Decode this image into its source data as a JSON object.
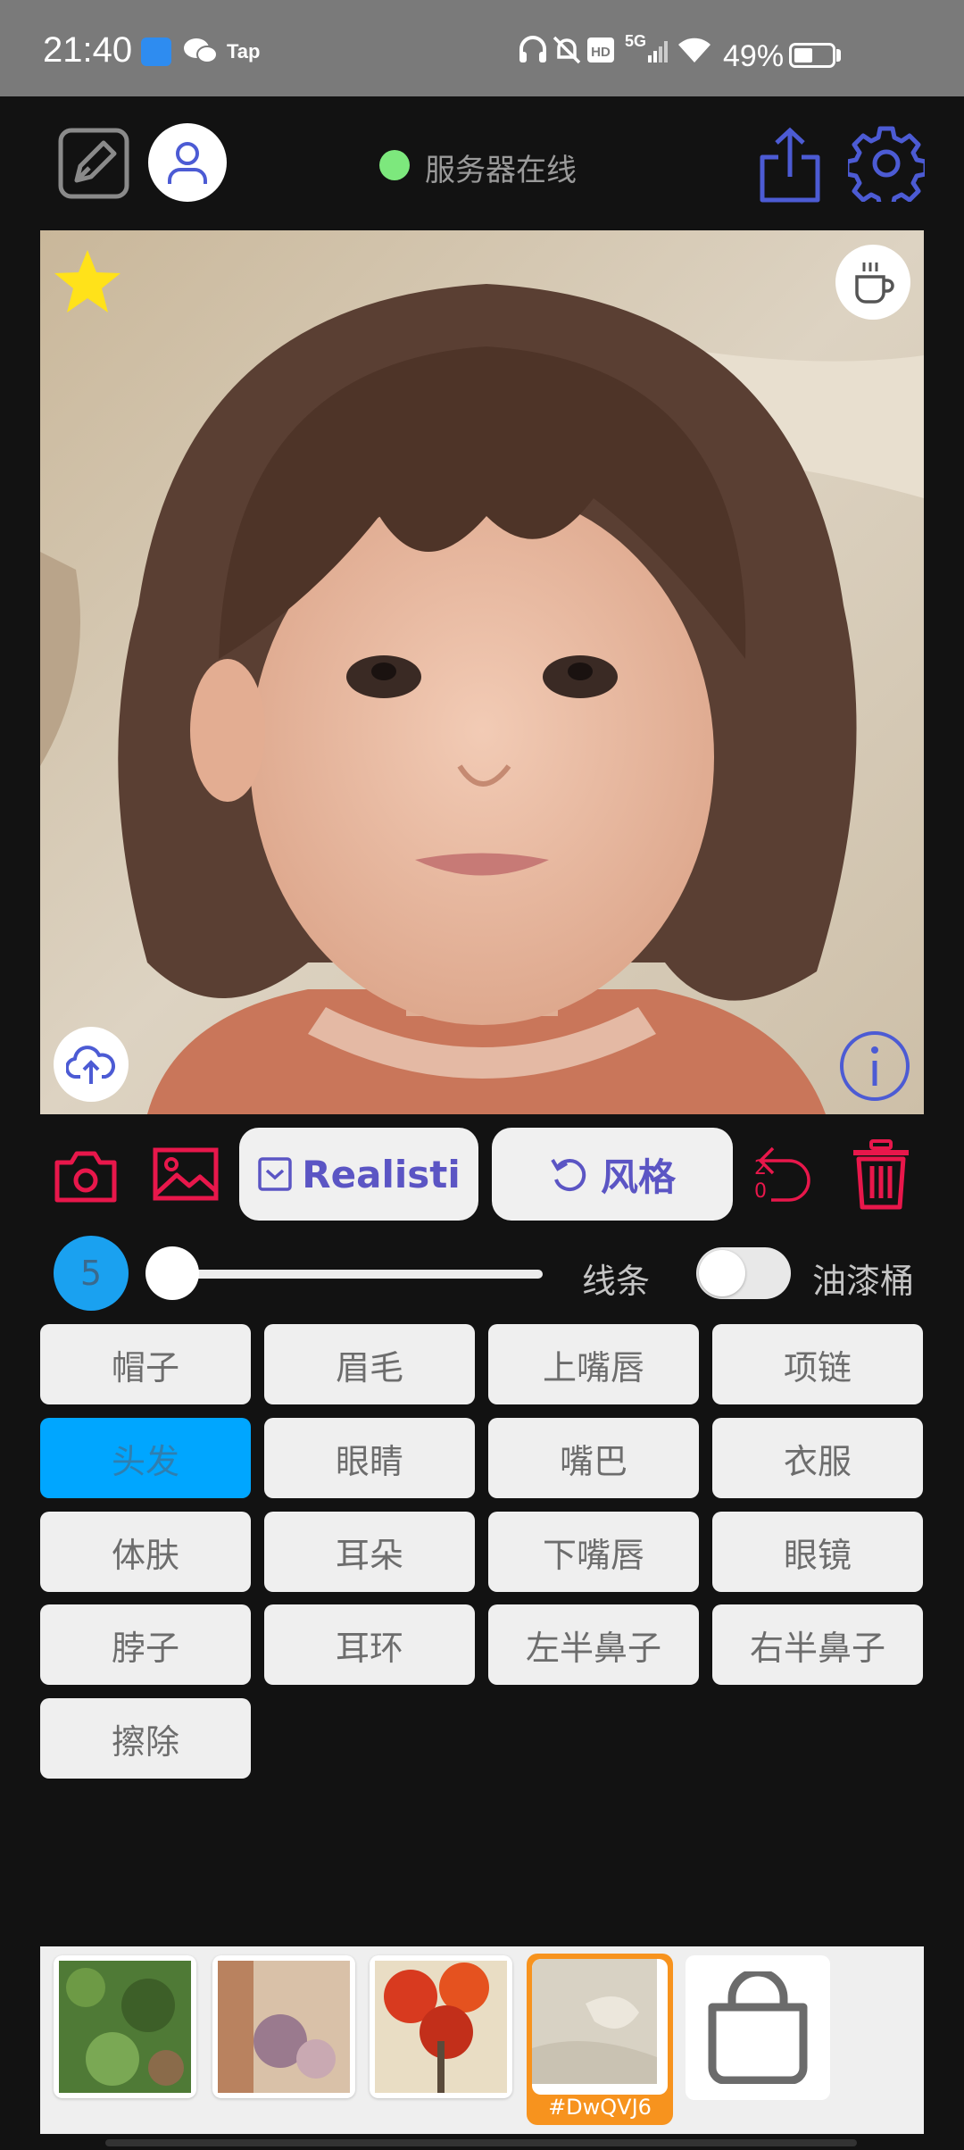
{
  "status_bar": {
    "time": "21:40",
    "tap_label": "Tap",
    "network_label": "5G",
    "battery": "49%",
    "battery_level": 0.49
  },
  "header": {
    "server_status": "服务器在线",
    "server_color": "#7de87d"
  },
  "toolbar": {
    "style_select_label": "Realisti",
    "style_button_label": "风格",
    "undo_count": "20",
    "accent_color": "#e8174b",
    "brand_color": "#5b55c4"
  },
  "brush": {
    "size": "5",
    "line_label": "线条",
    "bucket_label": "油漆桶",
    "slider_fraction": 0.0,
    "bucket_enabled": false
  },
  "parts": [
    {
      "label": "帽子"
    },
    {
      "label": "眉毛"
    },
    {
      "label": "上嘴唇"
    },
    {
      "label": "项链"
    },
    {
      "label": "头发",
      "active": true
    },
    {
      "label": "眼睛"
    },
    {
      "label": "嘴巴"
    },
    {
      "label": "衣服"
    },
    {
      "label": "体肤"
    },
    {
      "label": "耳朵"
    },
    {
      "label": "下嘴唇"
    },
    {
      "label": "眼镜"
    },
    {
      "label": "脖子"
    },
    {
      "label": "耳环"
    },
    {
      "label": "左半鼻子"
    },
    {
      "label": "右半鼻子"
    },
    {
      "label": "擦除"
    }
  ],
  "tray": {
    "selected_label": "#DwQVJ6",
    "selected_color": "#f7931e"
  },
  "icons": [
    "pen-square-icon",
    "user-icon",
    "share-icon",
    "gear-icon",
    "star-icon",
    "coffee-icon",
    "cloud-upload-icon",
    "info-icon",
    "camera-icon",
    "image-icon",
    "checkbox-icon",
    "rotate-icon",
    "undo-icon",
    "trash-icon",
    "shopping-bag-icon"
  ]
}
